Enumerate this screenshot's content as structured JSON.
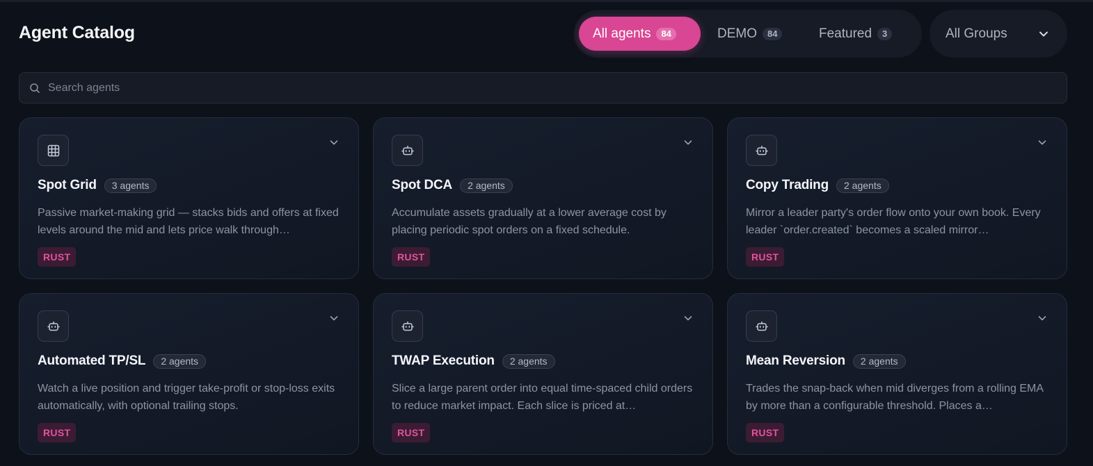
{
  "header": {
    "title": "Agent Catalog"
  },
  "filters": {
    "tabs": [
      {
        "label": "All agents",
        "count": "84",
        "active": true
      },
      {
        "label": "DEMO",
        "count": "84",
        "active": false
      },
      {
        "label": "Featured",
        "count": "3",
        "active": false
      }
    ],
    "groups_select": {
      "value": "All Groups"
    }
  },
  "search": {
    "placeholder": "Search agents",
    "value": ""
  },
  "cards": [
    {
      "icon": "grid-icon",
      "name": "Spot Grid",
      "agents": "3 agents",
      "description": "Passive market-making grid — stacks bids and offers at fixed levels around the mid and lets price walk through…",
      "language": "RUST"
    },
    {
      "icon": "bot-icon",
      "name": "Spot DCA",
      "agents": "2 agents",
      "description": "Accumulate assets gradually at a lower average cost by placing periodic spot orders on a fixed schedule.",
      "language": "RUST"
    },
    {
      "icon": "bot-icon",
      "name": "Copy Trading",
      "agents": "2 agents",
      "description": "Mirror a leader party's order flow onto your own book. Every leader `order.created` becomes a scaled mirror…",
      "language": "RUST"
    },
    {
      "icon": "bot-icon",
      "name": "Automated TP/SL",
      "agents": "2 agents",
      "description": "Watch a live position and trigger take-profit or stop-loss exits automatically, with optional trailing stops.",
      "language": "RUST"
    },
    {
      "icon": "bot-icon",
      "name": "TWAP Execution",
      "agents": "2 agents",
      "description": "Slice a large parent order into equal time-spaced child orders to reduce market impact. Each slice is priced at…",
      "language": "RUST"
    },
    {
      "icon": "bot-icon",
      "name": "Mean Reversion",
      "agents": "2 agents",
      "description": "Trades the snap-back when mid diverges from a rolling EMA by more than a configurable threshold. Places a…",
      "language": "RUST"
    }
  ],
  "colors": {
    "accent": "#d94693",
    "background": "#0d1119",
    "card": "#161d2d",
    "language_badge_bg": "#3b1c33",
    "language_badge_text": "#e0559d"
  }
}
